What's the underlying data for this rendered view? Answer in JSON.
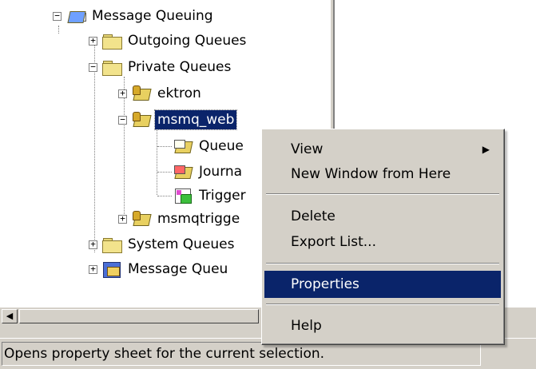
{
  "tree": {
    "items": [
      {
        "label": "Message Queuing",
        "icon": "message-queuing-icon"
      },
      {
        "label": "Outgoing Queues",
        "icon": "folder-icon"
      },
      {
        "label": "Private Queues",
        "icon": "folder-icon"
      },
      {
        "label": "ektron",
        "icon": "queue-icon"
      },
      {
        "label": "msmq_web",
        "icon": "queue-icon",
        "selected": true
      },
      {
        "label": "Queue",
        "icon": "queue-messages-icon"
      },
      {
        "label": "Journa",
        "icon": "journal-icon"
      },
      {
        "label": "Trigger",
        "icon": "triggers-icon"
      },
      {
        "label": "msmqtrigge",
        "icon": "queue-icon"
      },
      {
        "label": "System Queues",
        "icon": "folder-icon"
      },
      {
        "label": "Message Queu",
        "icon": "message-queue-icon"
      }
    ]
  },
  "context_menu": {
    "items": [
      {
        "label": "View",
        "submenu_arrow": "▶"
      },
      {
        "label": "New Window from Here"
      },
      {
        "label": "Delete"
      },
      {
        "label": "Export List..."
      },
      {
        "label": "Properties",
        "highlighted": true
      },
      {
        "label": "Help"
      }
    ]
  },
  "status_bar": {
    "text": "Opens property sheet for the current selection."
  },
  "scrollbar": {
    "left_arrow": "◀"
  },
  "colors": {
    "selection": "#0a246a",
    "chrome": "#d4d0c8"
  }
}
